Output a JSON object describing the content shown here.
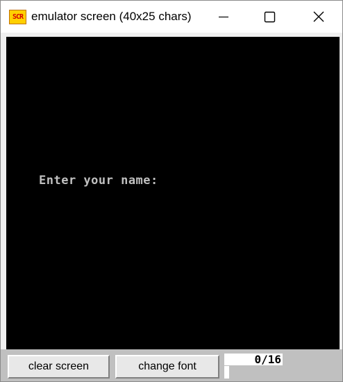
{
  "window": {
    "title": "emulator screen (40x25 chars)",
    "icon": "scr-app-icon",
    "icon_text": "SCR"
  },
  "caption_buttons": {
    "minimize": "minimize-icon",
    "maximize": "maximize-icon",
    "close": "close-icon"
  },
  "screen": {
    "background": "#000000",
    "text_color": "#c0c0c0",
    "line": "Enter your name:"
  },
  "controls": {
    "clear_label": "clear screen",
    "font_label": "change font",
    "counter": "0/16"
  }
}
